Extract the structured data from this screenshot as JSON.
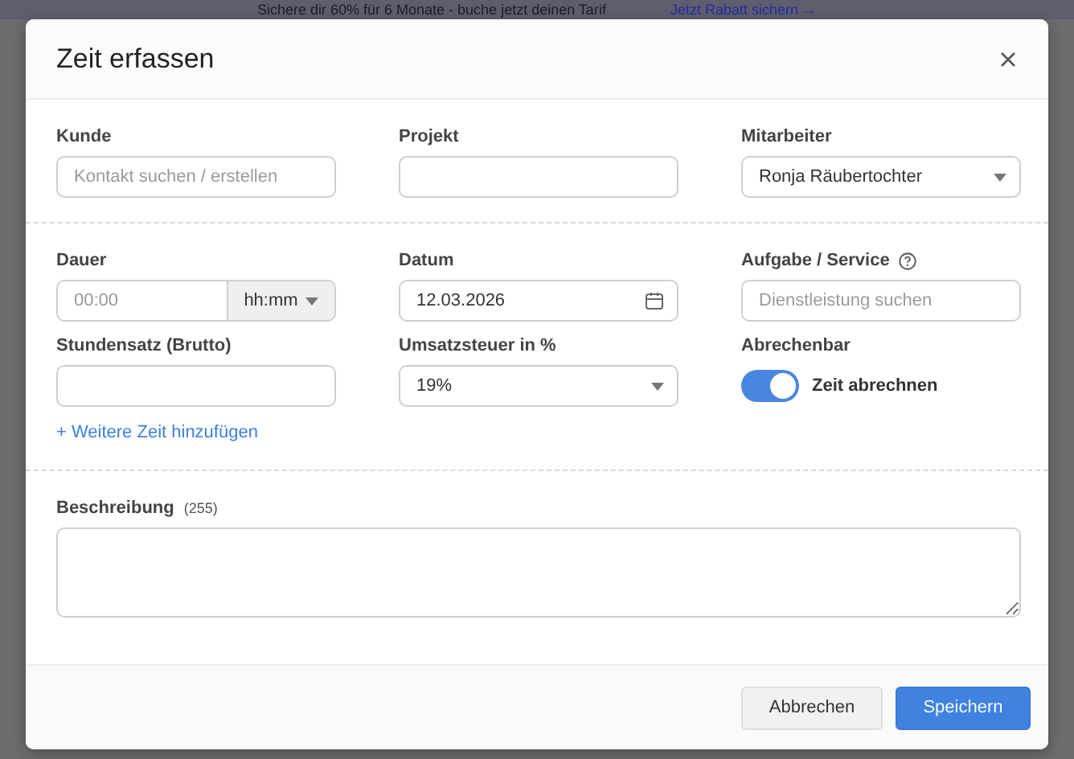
{
  "banner": {
    "text": "Sichere dir 60% für 6 Monate - buche jetzt deinen Tarif",
    "link": "Jetzt Rabatt sichern →"
  },
  "dialog": {
    "title": "Zeit erfassen"
  },
  "sections": [
    {
      "fields": [
        {
          "kind": "text",
          "label": "Kunde",
          "placeholder": "Kontakt suchen / erstellen"
        },
        {
          "kind": "text",
          "label": "Projekt"
        },
        {
          "kind": "select",
          "label": "Mitarbeiter",
          "value": "Ronja Räubertochter"
        }
      ]
    },
    {
      "fields": [
        {
          "kind": "duration",
          "label": "Dauer",
          "placeholder": "00:00",
          "unit": "hh:mm"
        },
        {
          "kind": "date",
          "label": "Datum",
          "value": "12.03.2026"
        },
        {
          "kind": "text",
          "label": "Aufgabe / Service",
          "placeholder": "Dienstleistung suchen",
          "help": true
        },
        {
          "kind": "text",
          "label": "Stundensatz (Brutto)"
        },
        {
          "kind": "select",
          "label": "Umsatzsteuer in %",
          "value": "19%"
        },
        {
          "kind": "toggle",
          "label": "Abrechenbar",
          "text": "Zeit abrechnen",
          "on": true
        }
      ],
      "link": "+ Weitere Zeit hinzufügen"
    },
    {
      "fields": [
        {
          "kind": "textarea",
          "label": "Beschreibung",
          "count": "(255)"
        }
      ]
    }
  ],
  "buttons": [
    {
      "label": "Abbrechen",
      "kind": "secondary"
    },
    {
      "label": "Speichern",
      "kind": "primary"
    }
  ]
}
